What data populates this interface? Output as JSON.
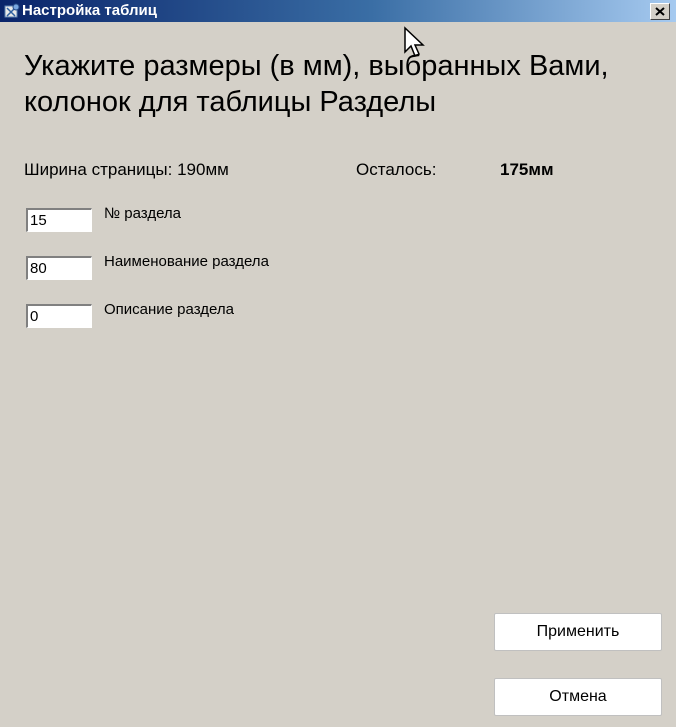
{
  "window": {
    "title": "Настройка таблиц",
    "close_symbol": "×"
  },
  "heading": "Укажите размеры (в мм), выбранных Вами, колонок для таблицы Разделы",
  "info": {
    "page_width_text": "Ширина страницы: 190мм",
    "remaining_label": "Осталось:",
    "remaining_value": "175мм"
  },
  "fields": [
    {
      "value": "15",
      "label": "№ раздела"
    },
    {
      "value": "80",
      "label": "Наименование раздела"
    },
    {
      "value": "0",
      "label": "Описание раздела"
    }
  ],
  "buttons": {
    "apply_label": "Применить",
    "cancel_label": "Отмена"
  },
  "icons": {
    "app": "app-icon",
    "close": "close-icon",
    "cursor": "mouse-cursor"
  },
  "colors": {
    "window_bg": "#d4d0c8",
    "titlebar_start": "#0a246a",
    "titlebar_end": "#a6caf0"
  }
}
